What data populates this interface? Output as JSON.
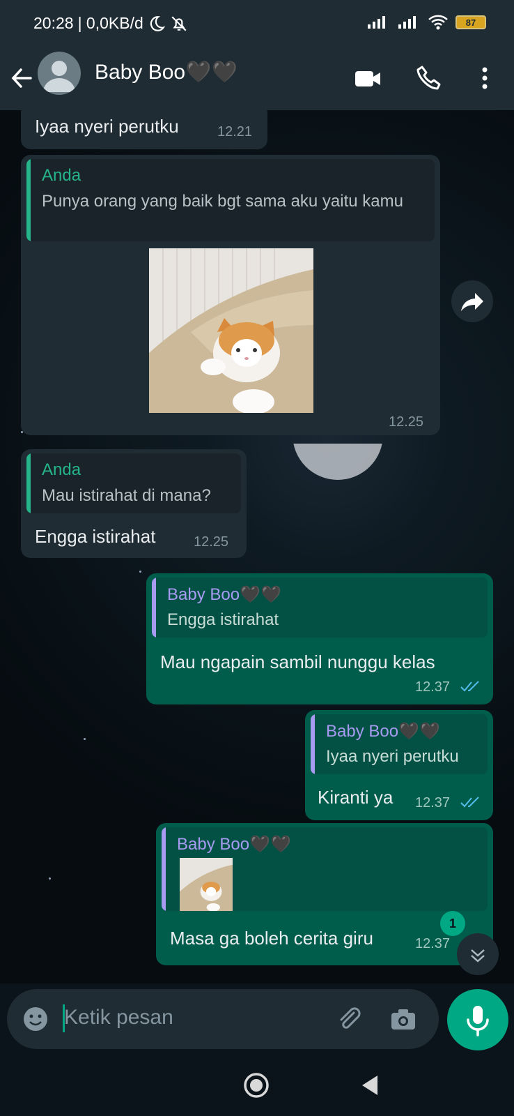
{
  "status_bar": {
    "time": "20:28",
    "data_speed": "| 0,0KB/d",
    "battery": "87"
  },
  "header": {
    "contact_name": "Baby Boo🖤🖤"
  },
  "messages": [
    {
      "type": "incoming",
      "text": "Iyaa nyeri perutku",
      "time": "12.21"
    },
    {
      "type": "incoming",
      "quote_author": "Anda",
      "quote_text": "Punya orang yang baik bgt sama aku yaitu kamu",
      "image": "cat-photo",
      "time": "12.25"
    },
    {
      "type": "incoming",
      "quote_author": "Anda",
      "quote_text": "Mau istirahat di mana?",
      "text": "Engga istirahat",
      "time": "12.25"
    },
    {
      "type": "outgoing",
      "quote_author": "Baby Boo🖤🖤",
      "quote_text": "Engga istirahat",
      "text": "Mau ngapain sambil nunggu kelas",
      "time": "12.37"
    },
    {
      "type": "outgoing",
      "quote_author": "Baby Boo🖤🖤",
      "quote_text": "Iyaa nyeri perutku",
      "text": "Kiranti ya",
      "time": "12.37"
    },
    {
      "type": "outgoing",
      "quote_author": "Baby Boo🖤🖤",
      "quote_image": "cat-thumbnail",
      "text": "Masa ga boleh cerita giru",
      "time": "12.37"
    }
  ],
  "unread_count": "1",
  "composer": {
    "placeholder": "Ketik pesan"
  },
  "colors": {
    "header_bg": "#1f2c34",
    "incoming_bubble": "#202c33",
    "outgoing_bubble": "#005c4b",
    "accent": "#00a884",
    "quote_name_in": "#25b58a",
    "quote_name_out": "#a79bf1"
  },
  "icons": [
    "back-arrow-icon",
    "avatar-icon",
    "video-call-icon",
    "phone-icon",
    "more-options-icon",
    "forward-icon",
    "double-check-icon",
    "scroll-down-icon",
    "emoji-icon",
    "attach-icon",
    "camera-icon",
    "mic-icon",
    "home-nav-icon",
    "back-nav-icon"
  ]
}
